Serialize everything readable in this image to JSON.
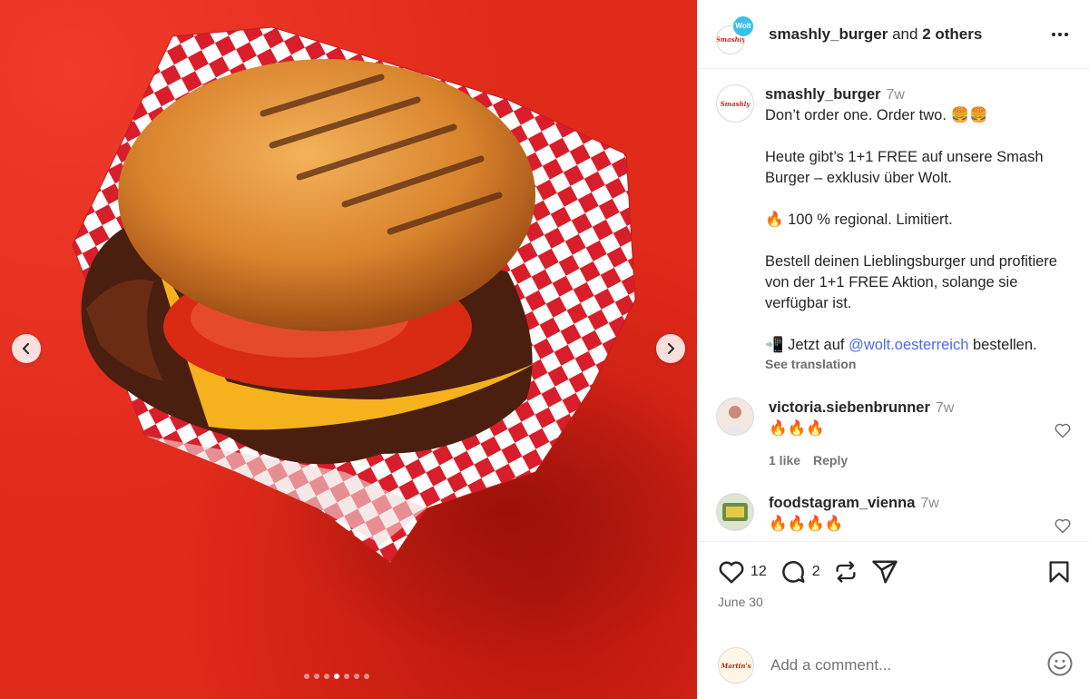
{
  "post": {
    "header": {
      "author": "smashly_burger",
      "and_text": "and",
      "others": "2 others",
      "collab_badge": "Wolt",
      "avatar_text": "Smashly"
    },
    "caption": {
      "username": "smashly_burger",
      "time": "7w",
      "line1": "Don’t order one. Order two. 🍔🍔",
      "line2": "Heute gibt’s 1+1 FREE auf unsere Smash Burger – exklusiv über Wolt.",
      "line3": "🔥 100 % regional. Limitiert.",
      "line4": "Bestell deinen Lieblingsburger und profitiere von der 1+1 FREE Aktion, solange sie verfügbar ist.",
      "line5_prefix": "📲 Jetzt auf ",
      "line5_link": "@wolt.oesterreich",
      "line5_suffix": " bestellen.",
      "see_translation": "See translation"
    },
    "comments": [
      {
        "username": "victoria.siebenbrunner",
        "time": "7w",
        "text": "🔥🔥🔥",
        "likes": "1 like",
        "reply": "Reply"
      },
      {
        "username": "foodstagram_vienna",
        "time": "7w",
        "text": "🔥🔥🔥🔥"
      }
    ],
    "actions": {
      "like_count": "12",
      "comment_count": "2"
    },
    "date": "June 30",
    "add_comment": {
      "placeholder": "Add a comment...",
      "avatar_text": "Martin's"
    },
    "carousel": {
      "total": 7,
      "active_index": 3
    },
    "colors": {
      "background_red": "#e02a1a",
      "link_blue": "#4a6ce3",
      "wolt_blue": "#3bc1e8"
    }
  }
}
